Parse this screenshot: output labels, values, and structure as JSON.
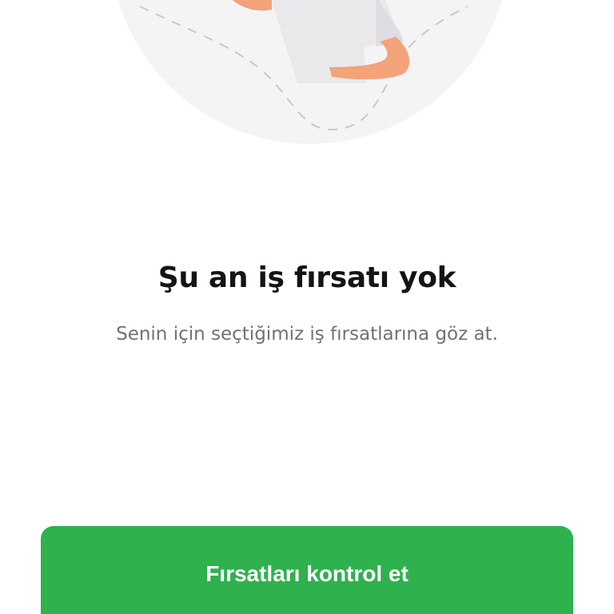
{
  "empty_state": {
    "illustration_icon": "person-illustration",
    "title": "Şu an iş fırsatı yok",
    "subtitle": "Senin için seçtiğimiz iş fırsatlarına göz at."
  },
  "cta": {
    "label": "Fırsatları kontrol et"
  },
  "colors": {
    "accent": "#2fb14e",
    "title": "#141414",
    "subtitle": "#6e7278",
    "illustration_bg": "#f4f4f4",
    "skin": "#f4a27a"
  }
}
